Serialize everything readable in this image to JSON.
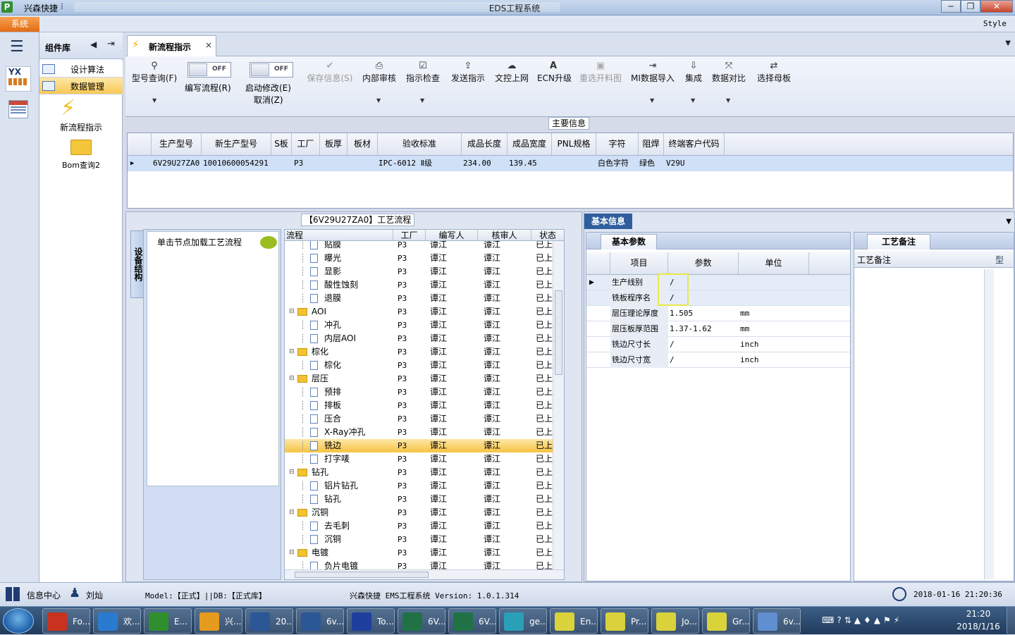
{
  "window": {
    "app_title": "兴森快捷",
    "center_title": "EDS工程系统",
    "min": "─",
    "restore": "❐",
    "close": "✕"
  },
  "menu": {
    "system": "系统",
    "style": "Style"
  },
  "left_panel": {
    "title": "组件库",
    "items": [
      {
        "label": "设计算法"
      },
      {
        "label": "数据管理"
      }
    ],
    "tools": [
      {
        "label": "新流程指示"
      },
      {
        "label": "Bom查询2"
      }
    ]
  },
  "tabs": [
    {
      "label": "新流程指示",
      "close": "×"
    }
  ],
  "ribbon": {
    "query": "型号查询(F)",
    "toggle1": {
      "state": "OFF",
      "label": "编写流程(R)"
    },
    "toggle2": {
      "state": "OFF",
      "label": "启动修改(E)",
      "sub": "取消(Z)"
    },
    "buttons": [
      {
        "label": "保存信息(S)",
        "icon": "✔",
        "enabled": false
      },
      {
        "label": "内部审核",
        "icon": "⎙",
        "enabled": true
      },
      {
        "label": "指示检查",
        "icon": "☑",
        "enabled": true
      },
      {
        "label": "发送指示",
        "icon": "⇪",
        "enabled": true
      },
      {
        "label": "文控上网",
        "icon": "☁",
        "enabled": true
      },
      {
        "label": "ECN升级",
        "icon": "A",
        "enabled": true
      },
      {
        "label": "重选开料图",
        "icon": "▣",
        "enabled": false
      },
      {
        "label": "MI数据导入",
        "icon": "⇥",
        "enabled": true
      },
      {
        "label": "集成",
        "icon": "⇩",
        "enabled": true
      },
      {
        "label": "数据对比",
        "icon": "⤧",
        "enabled": true
      },
      {
        "label": "选择母板",
        "icon": "⇄",
        "enabled": true
      }
    ]
  },
  "main_info": {
    "title": "主要信息",
    "headers": [
      "生产型号",
      "新生产型号",
      "S板",
      "工厂",
      "板厚",
      "板材",
      "验收标准",
      "成品长度",
      "成品宽度",
      "PNL规格",
      "字符",
      "阻焊",
      "终端客户代码"
    ],
    "rows": [
      [
        "6V29U27ZA0",
        "10010600054291",
        "",
        "P3",
        "",
        "",
        "IPC-6012 Ⅱ级",
        "234.00",
        "139.45",
        "",
        "白色字符",
        "绿色",
        "V29U"
      ]
    ]
  },
  "process": {
    "title": "【6V29U27ZA0】工艺流程",
    "side_tab": "设备结构",
    "hint": "单击节点加载工艺流程",
    "headers": [
      "流程",
      "工厂",
      "编写人",
      "核审人",
      "状态"
    ],
    "rows": [
      {
        "name": "贴膜",
        "level": 2,
        "folder": false,
        "factory": "P3",
        "writer": "谭江",
        "reviewer": "谭江",
        "status": "已上网"
      },
      {
        "name": "曝光",
        "level": 2,
        "folder": false,
        "factory": "P3",
        "writer": "谭江",
        "reviewer": "谭江",
        "status": "已上网"
      },
      {
        "name": "显影",
        "level": 2,
        "folder": false,
        "factory": "P3",
        "writer": "谭江",
        "reviewer": "谭江",
        "status": "已上网"
      },
      {
        "name": "酸性蚀刻",
        "level": 2,
        "folder": false,
        "factory": "P3",
        "writer": "谭江",
        "reviewer": "谭江",
        "status": "已上网"
      },
      {
        "name": "退膜",
        "level": 2,
        "folder": false,
        "factory": "P3",
        "writer": "谭江",
        "reviewer": "谭江",
        "status": "已上网"
      },
      {
        "name": "AOI",
        "level": 1,
        "folder": true,
        "factory": "P3",
        "writer": "谭江",
        "reviewer": "谭江",
        "status": "已上网"
      },
      {
        "name": "冲孔",
        "level": 2,
        "folder": false,
        "factory": "P3",
        "writer": "谭江",
        "reviewer": "谭江",
        "status": "已上网"
      },
      {
        "name": "内层AOI",
        "level": 2,
        "folder": false,
        "factory": "P3",
        "writer": "谭江",
        "reviewer": "谭江",
        "status": "已上网"
      },
      {
        "name": "棕化",
        "level": 1,
        "folder": true,
        "factory": "P3",
        "writer": "谭江",
        "reviewer": "谭江",
        "status": "已上网"
      },
      {
        "name": "棕化",
        "level": 2,
        "folder": false,
        "factory": "P3",
        "writer": "谭江",
        "reviewer": "谭江",
        "status": "已上网"
      },
      {
        "name": "层压",
        "level": 1,
        "folder": true,
        "factory": "P3",
        "writer": "谭江",
        "reviewer": "谭江",
        "status": "已上网"
      },
      {
        "name": "预排",
        "level": 2,
        "folder": false,
        "factory": "P3",
        "writer": "谭江",
        "reviewer": "谭江",
        "status": "已上网"
      },
      {
        "name": "排板",
        "level": 2,
        "folder": false,
        "factory": "P3",
        "writer": "谭江",
        "reviewer": "谭江",
        "status": "已上网"
      },
      {
        "name": "压合",
        "level": 2,
        "folder": false,
        "factory": "P3",
        "writer": "谭江",
        "reviewer": "谭江",
        "status": "已上网"
      },
      {
        "name": "X-Ray冲孔",
        "level": 2,
        "folder": false,
        "factory": "P3",
        "writer": "谭江",
        "reviewer": "谭江",
        "status": "已上网"
      },
      {
        "name": "铣边",
        "level": 2,
        "folder": false,
        "factory": "P3",
        "writer": "谭江",
        "reviewer": "谭江",
        "status": "已上网",
        "selected": true
      },
      {
        "name": "打字唛",
        "level": 2,
        "folder": false,
        "factory": "P3",
        "writer": "谭江",
        "reviewer": "谭江",
        "status": "已上网"
      },
      {
        "name": "钻孔",
        "level": 1,
        "folder": true,
        "factory": "P3",
        "writer": "谭江",
        "reviewer": "谭江",
        "status": "已上网"
      },
      {
        "name": "铝片钻孔",
        "level": 2,
        "folder": false,
        "factory": "P3",
        "writer": "谭江",
        "reviewer": "谭江",
        "status": "已上网"
      },
      {
        "name": "钻孔",
        "level": 2,
        "folder": false,
        "factory": "P3",
        "writer": "谭江",
        "reviewer": "谭江",
        "status": "已上网"
      },
      {
        "name": "沉铜",
        "level": 1,
        "folder": true,
        "factory": "P3",
        "writer": "谭江",
        "reviewer": "谭江",
        "status": "已上网"
      },
      {
        "name": "去毛刺",
        "level": 2,
        "folder": false,
        "factory": "P3",
        "writer": "谭江",
        "reviewer": "谭江",
        "status": "已上网"
      },
      {
        "name": "沉铜",
        "level": 2,
        "folder": false,
        "factory": "P3",
        "writer": "谭江",
        "reviewer": "谭江",
        "status": "已上网"
      },
      {
        "name": "电镀",
        "level": 1,
        "folder": true,
        "factory": "P3",
        "writer": "谭江",
        "reviewer": "谭江",
        "status": "已上网"
      },
      {
        "name": "负片电镀",
        "level": 2,
        "folder": false,
        "factory": "P3",
        "writer": "谭江",
        "reviewer": "谭江",
        "status": "已上网"
      }
    ]
  },
  "basic_info": {
    "title": "基本信息",
    "tab": "基本参数",
    "headers": [
      "项目",
      "参数",
      "单位"
    ],
    "rows": [
      {
        "item": "生产线别",
        "param": "/",
        "unit": ""
      },
      {
        "item": "铣板程序名",
        "param": "/",
        "unit": ""
      },
      {
        "item": "层压理论厚度",
        "param": "1.505",
        "unit": "mm"
      },
      {
        "item": "层压板厚范围",
        "param": "1.37-1.62",
        "unit": "mm"
      },
      {
        "item": "铣边尺寸长",
        "param": "/",
        "unit": "inch"
      },
      {
        "item": "铣边尺寸宽",
        "param": "/",
        "unit": "inch"
      }
    ]
  },
  "remarks": {
    "tab": "工艺备注",
    "col1": "工艺备注",
    "col2": "型"
  },
  "status": {
    "info_center": "信息中心",
    "user": "刘灿",
    "model": "Model:【正式】||DB:【正式库】",
    "version": "兴森快捷 EMS工程系统 Version: 1.0.1.314",
    "datetime": "2018-01-16 21:20:36"
  },
  "taskbar": {
    "items": [
      {
        "label": "Fo...",
        "color": "#c8321e"
      },
      {
        "label": "欢...",
        "color": "#2a7bd0"
      },
      {
        "label": "E...",
        "color": "#2f8f2f"
      },
      {
        "label": "兴...",
        "color": "#e59b1d"
      },
      {
        "label": "20...",
        "color": "#2b5797"
      },
      {
        "label": "6v...",
        "color": "#2b5797"
      },
      {
        "label": "To...",
        "color": "#1e3f9e"
      },
      {
        "label": "6V...",
        "color": "#207245"
      },
      {
        "label": "6V...",
        "color": "#207245"
      },
      {
        "label": "ge...",
        "color": "#2aa0b8"
      },
      {
        "label": "En...",
        "color": "#d9d23a"
      },
      {
        "label": "Pr...",
        "color": "#d9d23a"
      },
      {
        "label": "Jo...",
        "color": "#d9d23a"
      },
      {
        "label": "Gr...",
        "color": "#d9d23a"
      },
      {
        "label": "6v...",
        "color": "#5f8fd0"
      }
    ],
    "time": "21:20",
    "date": "2018/1/16"
  }
}
